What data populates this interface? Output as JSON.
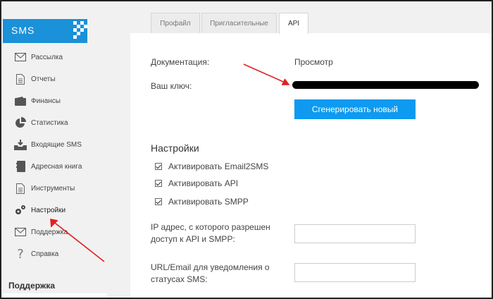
{
  "sidebar": {
    "brand": "SMS",
    "items": [
      {
        "label": "Рассылка",
        "icon": "envelope-icon"
      },
      {
        "label": "Отчеты",
        "icon": "document-icon"
      },
      {
        "label": "Финансы",
        "icon": "wallet-icon"
      },
      {
        "label": "Статистика",
        "icon": "pie-chart-icon"
      },
      {
        "label": "Входящие SMS",
        "icon": "inbox-icon"
      },
      {
        "label": "Адресная книга",
        "icon": "address-book-icon"
      },
      {
        "label": "Инструменты",
        "icon": "tools-document-icon"
      },
      {
        "label": "Настройки",
        "icon": "gears-icon"
      },
      {
        "label": "Поддержка",
        "icon": "envelope-icon"
      },
      {
        "label": "Справка",
        "icon": "question-icon"
      }
    ],
    "support_title": "Поддержка"
  },
  "tabs": [
    {
      "label": "Профайл"
    },
    {
      "label": "Пригласительные"
    },
    {
      "label": "API"
    }
  ],
  "api": {
    "docs_label": "Документация:",
    "docs_value": "Просмотр",
    "key_label": "Ваш ключ:",
    "generate_button": "Сгенерировать новый"
  },
  "settings": {
    "title": "Настройки",
    "checks": [
      {
        "label": "Активировать Email2SMS"
      },
      {
        "label": "Активировать API"
      },
      {
        "label": "Активировать SMPP"
      }
    ],
    "ip_label": "IP адрес, с которого разрешен доступ к API и SMPP:",
    "url_label": "URL/Email для уведомления о статусах SMS:"
  },
  "colors": {
    "brand": "#1a91d8",
    "button": "#0d9af0",
    "arrow": "#e02020"
  }
}
